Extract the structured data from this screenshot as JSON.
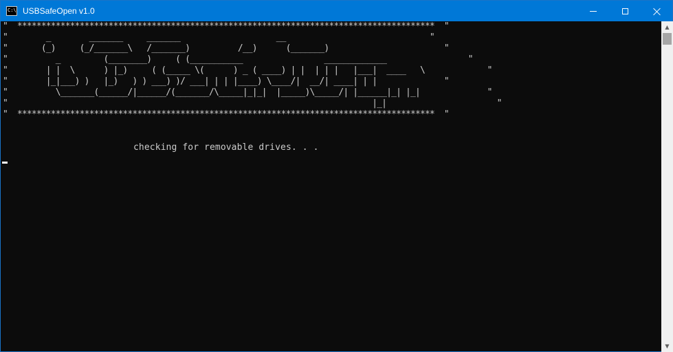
{
  "window": {
    "title": "USBSafeOpen v1.0",
    "icon": "console-icon",
    "icon_text": "C:\\."
  },
  "console": {
    "banner": "\"  ***************************************************************************************  \"\n\"        _        _______     _______                    __                              \"\n\"       (_)     (_/_______\\   /_______)          /__)      (_______)                        \"\n\"          _         (________)     ( (___________                 _____________                 \"\n\"        | |  \\      ) |_)     ( (_____ \\(      ) _ ( ____) | |  | | |   |___|  ____   \\             \"\n\"        |_|___) )   |_)   ) ) ___) )/ ___| | | |____) \\____/|  __/| ____| | |              \"\n\"          \\_______(______/|______/(_______/\\_____|_|_|  |_____)\\_____/| |______|_| |_|              \"\n\"                                                                            |_|                       \"\n\"  ***************************************************************************************  \"",
    "status_line": "checking for removable drives. . ."
  },
  "colors": {
    "titlebar": "#0078d7",
    "console_bg": "#0c0c0c",
    "console_text": "#cccccc"
  }
}
